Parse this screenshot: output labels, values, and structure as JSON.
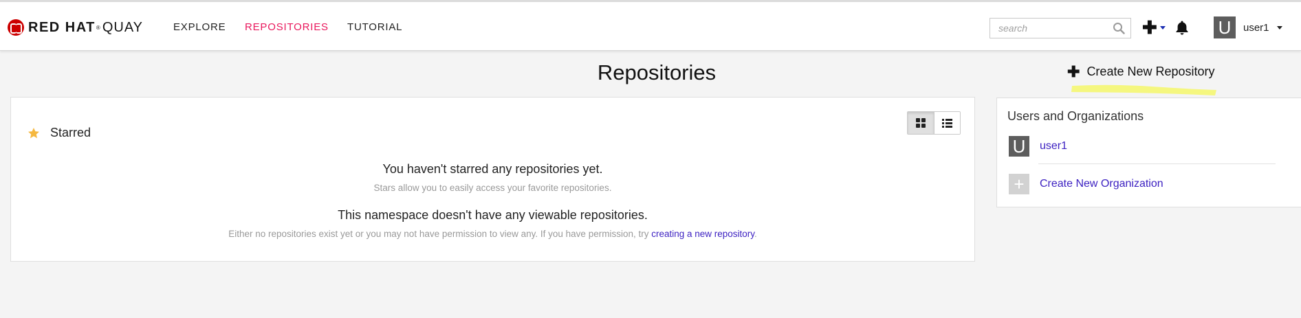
{
  "navbar": {
    "brand": {
      "strong": "RED HAT",
      "reg": "®",
      "light": "QUAY"
    },
    "links": [
      {
        "label": "EXPLORE"
      },
      {
        "label": "REPOSITORIES",
        "active": true
      },
      {
        "label": "TUTORIAL"
      }
    ],
    "search": {
      "value": "",
      "placeholder": "search"
    },
    "create_menu": {
      "glyph": "✚"
    },
    "user": {
      "avatar_letter": "U",
      "name": "user1"
    }
  },
  "page": {
    "title": "Repositories",
    "create_repo": {
      "glyph": "✚",
      "label": "Create New Repository"
    }
  },
  "starred": {
    "title": "Starred",
    "empty_title": "You haven't starred any repositories yet.",
    "empty_sub": "Stars allow you to easily access your favorite repositories.",
    "namespace_title": "This namespace doesn't have any viewable repositories.",
    "namespace_sub_before": "Either no repositories exist yet or you may not have permission to view any. If you have permission, try ",
    "namespace_sub_link": "creating a new repository",
    "namespace_sub_after": "."
  },
  "sidebar": {
    "title": "Users and Organizations",
    "user": {
      "avatar_letter": "U",
      "name": "user1"
    },
    "create_org": {
      "glyph": "+",
      "label": "Create New Organization"
    }
  },
  "colors": {
    "accent_pink": "#e9175c",
    "link_purple": "#3b1fc1",
    "brand_red": "#cc0000",
    "star_yellow": "#f5b840",
    "highlight_yellow": "#f4f76a"
  },
  "icons": [
    "search-icon",
    "plus-icon",
    "bell-icon",
    "star-icon",
    "grid-view-icon",
    "list-view-icon"
  ]
}
